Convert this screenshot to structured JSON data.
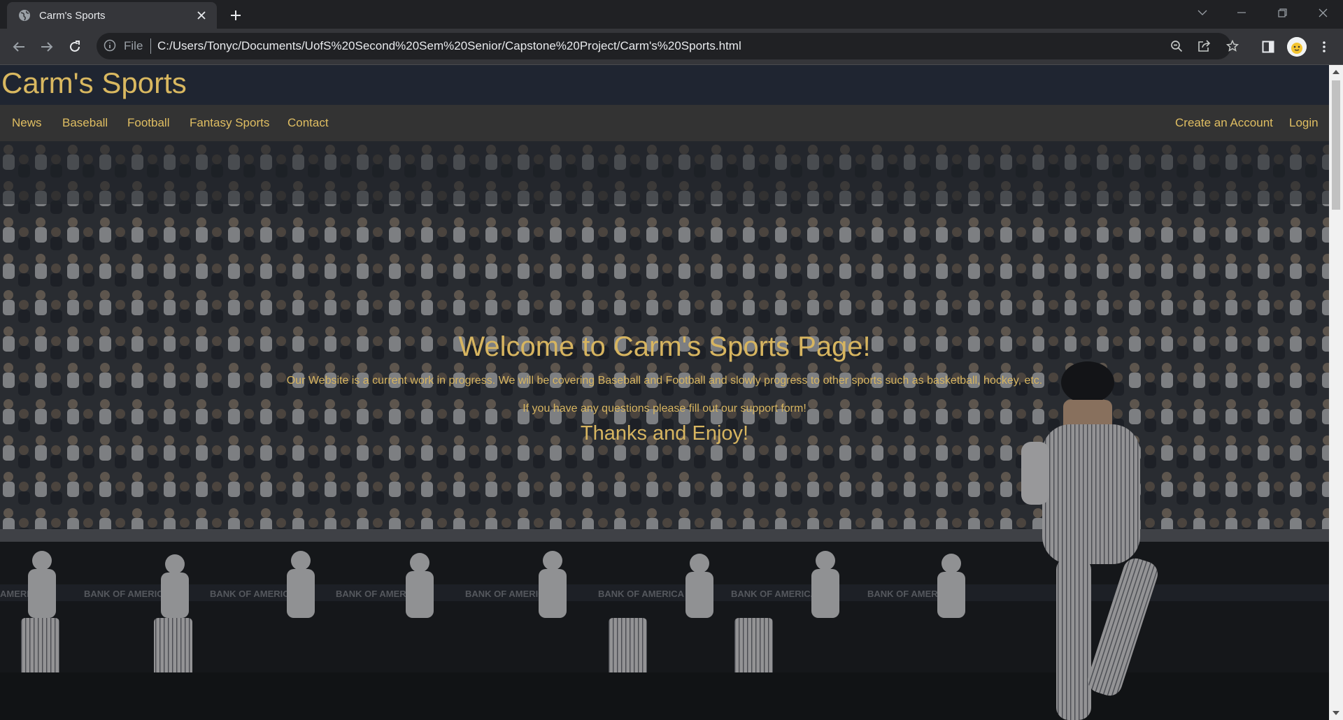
{
  "browser": {
    "tab_title": "Carm's Sports",
    "scheme_label": "File",
    "url": "C:/Users/Tonyc/Documents/UofS%20Second%20Sem%20Senior/Capstone%20Project/Carm's%20Sports.html"
  },
  "site": {
    "title": "Carm's Sports",
    "nav_left": [
      "News",
      "Baseball",
      "Football",
      "Fantasy Sports",
      "Contact"
    ],
    "nav_right": [
      "Create an Account",
      "Login"
    ]
  },
  "hero": {
    "heading": "Welcome to Carm's Sports Page!",
    "paragraph1": "Our Website is a current work in progress. We will be covering Baseball and Football and slowly progress to other sports such as basketball, hockey, etc.",
    "paragraph2": "If you have any questions please fill out our support form!",
    "subheading": "Thanks and Enjoy!",
    "background_signage": "BANK OF AMERICA"
  },
  "colors": {
    "accent_gold": "#d9b860",
    "header_bg": "#1f2531",
    "nav_bg": "#333333",
    "chrome_bg": "#202124",
    "toolbar_bg": "#35363a"
  },
  "icons": {
    "favicon": "globe-icon",
    "tab_close": "close-icon",
    "new_tab": "plus-icon",
    "back": "back-arrow-icon",
    "forward": "forward-arrow-icon",
    "reload": "reload-icon",
    "site_info": "info-icon",
    "zoom": "zoom-icon",
    "share": "share-icon",
    "bookmark": "star-icon",
    "side_panel": "side-panel-icon",
    "profile": "avatar",
    "menu": "kebab-menu-icon"
  }
}
